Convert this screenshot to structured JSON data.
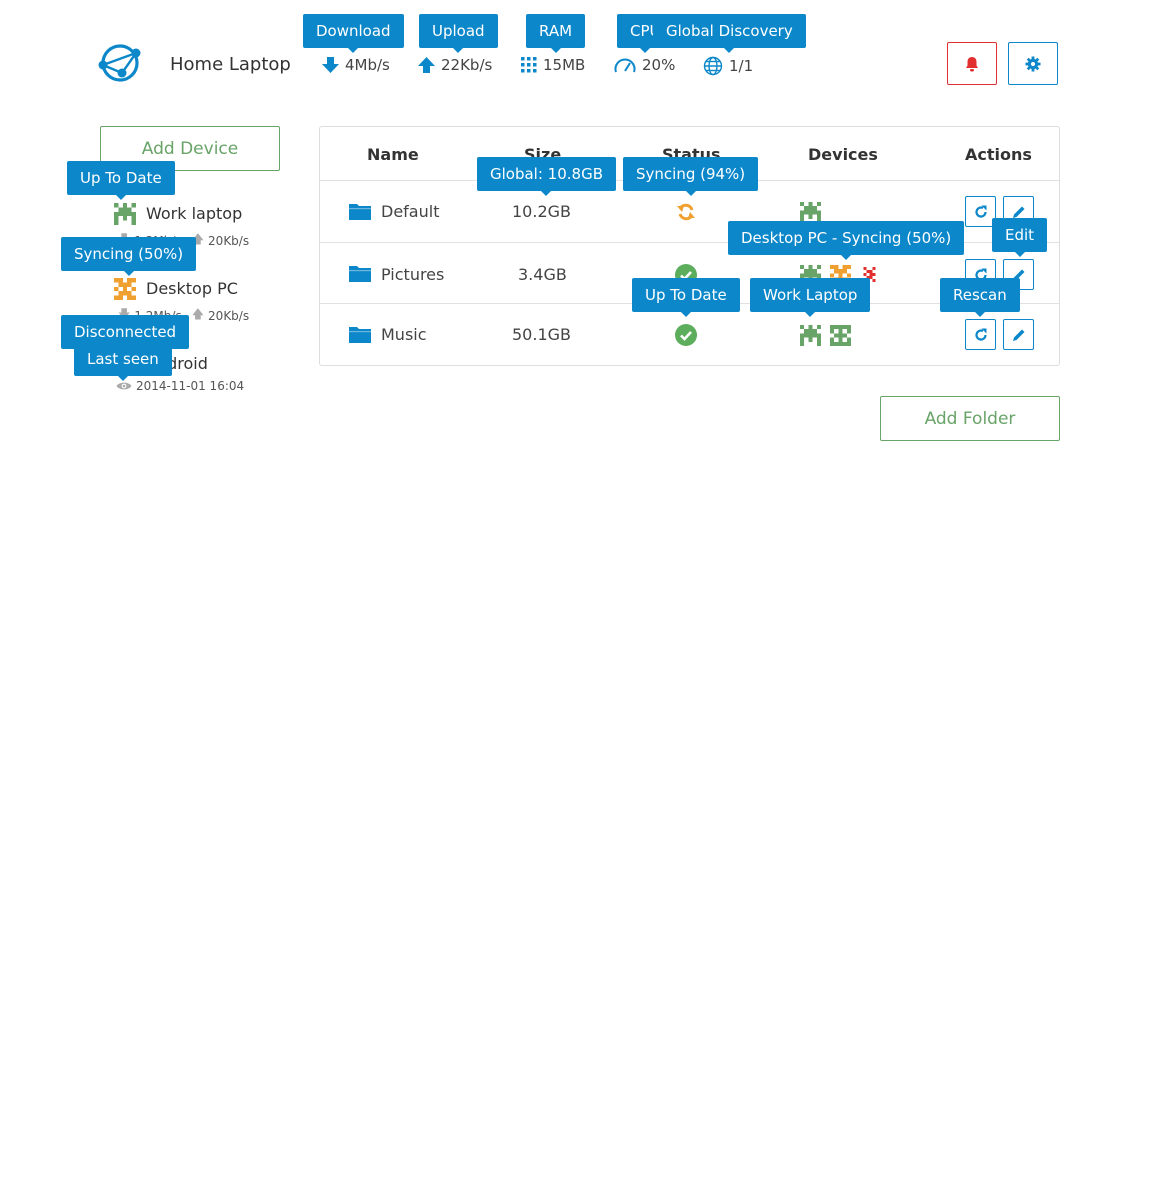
{
  "header": {
    "device_name": "Home Laptop",
    "download": "4Mb/s",
    "upload": "22Kb/s",
    "ram": "15MB",
    "cpu": "20%",
    "discovery": "1/1"
  },
  "tooltips": {
    "download": "Download",
    "upload": "Upload",
    "ram": "RAM",
    "cpu": "CPU",
    "discovery": "Global Discovery",
    "work_laptop_status": "Up To Date",
    "desktop_status": "Syncing (50%)",
    "android_status": "Disconnected",
    "last_seen": "Last seen",
    "global_size": "Global: 10.8GB",
    "default_status": "Syncing (94%)",
    "pictures_desktop": "Desktop PC - Syncing (50%)",
    "edit": "Edit",
    "music_status": "Up To Date",
    "music_work_laptop": "Work Laptop",
    "rescan": "Rescan"
  },
  "sidebar": {
    "add_device": "Add Device",
    "devices": [
      {
        "name": "Work laptop",
        "down": "1.2Mb/s",
        "up": "20Kb/s"
      },
      {
        "name": "Desktop PC",
        "down": "1.2Mb/s",
        "up": "20Kb/s"
      },
      {
        "name": "Android",
        "last_seen": "2014-11-01 16:04"
      }
    ]
  },
  "table": {
    "headers": [
      "Name",
      "Size",
      "Status",
      "Devices",
      "Actions"
    ],
    "rows": [
      {
        "name": "Default",
        "size": "10.2GB",
        "status": "syncing"
      },
      {
        "name": "Pictures",
        "size": "3.4GB",
        "status": "up-to-date"
      },
      {
        "name": "Music",
        "size": "50.1GB",
        "status": "up-to-date"
      }
    ]
  },
  "add_folder": "Add Folder",
  "colors": {
    "accent": "#0c87c9",
    "green": "#68a368",
    "orange": "#f0a030",
    "red": "#e23030"
  },
  "icons": [
    "logo-icon",
    "download-icon",
    "upload-icon",
    "ram-icon",
    "cpu-icon",
    "globe-icon",
    "bell-icon",
    "gear-icon",
    "folder-icon",
    "sync-icon",
    "check-icon",
    "rescan-icon",
    "edit-icon",
    "eye-icon"
  ]
}
